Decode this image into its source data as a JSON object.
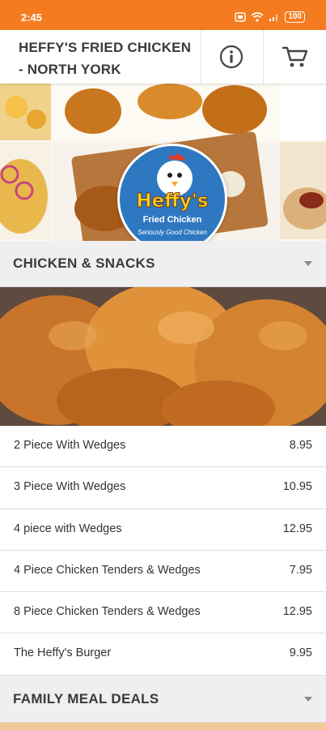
{
  "status_bar": {
    "time": "2:45",
    "battery": "100"
  },
  "header": {
    "title": "HEFFY'S FRIED CHICKEN - NORTH YORK"
  },
  "logo": {
    "name": "Heffy's",
    "subtitle": "Fried Chicken",
    "tagline": "Seriously Good Chicken"
  },
  "sections": [
    {
      "title": "CHICKEN & SNACKS",
      "items": [
        {
          "name": "2 Piece With Wedges",
          "price": "8.95"
        },
        {
          "name": "3 Piece With Wedges",
          "price": "10.95"
        },
        {
          "name": "4 piece with Wedges",
          "price": "12.95"
        },
        {
          "name": "4 Piece Chicken Tenders & Wedges",
          "price": "7.95"
        },
        {
          "name": "8 Piece Chicken Tenders & Wedges",
          "price": "12.95"
        },
        {
          "name": "The Heffy's Burger",
          "price": "9.95"
        }
      ]
    },
    {
      "title": "FAMILY MEAL DEALS",
      "items": []
    }
  ],
  "colors": {
    "status_bar": "#f47b20",
    "logo_blue": "#2e78c1",
    "logo_yellow": "#ffd21f"
  },
  "icons": [
    "info-icon",
    "cart-icon",
    "chevron-down-icon",
    "wifi-icon",
    "signal-icon",
    "battery-icon"
  ]
}
